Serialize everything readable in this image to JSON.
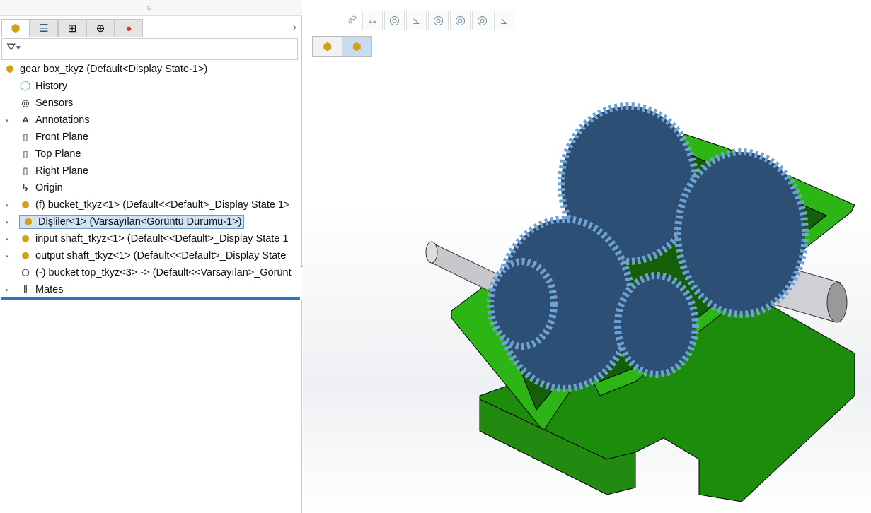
{
  "tabs": [
    {
      "name": "feature-manager",
      "icon": "assembly-icon",
      "active": true
    },
    {
      "name": "property-manager",
      "icon": "property-list-icon"
    },
    {
      "name": "configuration-manager",
      "icon": "configuration-icon"
    },
    {
      "name": "dimxpert-manager",
      "icon": "crosshair-icon"
    },
    {
      "name": "display-manager",
      "icon": "appearance-icon"
    }
  ],
  "filter": {
    "icon": "filter-icon"
  },
  "tree": {
    "root": "gear box_tkyz  (Default<Display State-1>)",
    "items": [
      {
        "label": "History",
        "icon": "history-icon",
        "expandable": false
      },
      {
        "label": "Sensors",
        "icon": "sensors-icon",
        "expandable": false
      },
      {
        "label": "Annotations",
        "icon": "annotations-icon",
        "expandable": true
      },
      {
        "label": "Front Plane",
        "icon": "plane-icon",
        "expandable": false
      },
      {
        "label": "Top Plane",
        "icon": "plane-icon",
        "expandable": false
      },
      {
        "label": "Right Plane",
        "icon": "plane-icon",
        "expandable": false
      },
      {
        "label": "Origin",
        "icon": "origin-icon",
        "expandable": false
      },
      {
        "label": "(f) bucket_tkyz<1> (Default<<Default>_Display State 1>",
        "icon": "part-icon",
        "expandable": true
      },
      {
        "label": "Dişliler<1> (Varsayılan<Görüntü Durumu-1>)",
        "icon": "subassembly-icon",
        "expandable": true,
        "selected": true
      },
      {
        "label": "input shaft_tkyz<1> (Default<<Default>_Display State 1",
        "icon": "part-icon",
        "expandable": true
      },
      {
        "label": "output shaft_tkyz<1> (Default<<Default>_Display State",
        "icon": "part-icon",
        "expandable": true
      },
      {
        "label": "(-) bucket top_tkyz<3> -> (Default<<Varsayılan>_Görünt",
        "icon": "suppressed-part-icon",
        "expandable": false
      },
      {
        "label": "Mates",
        "icon": "mates-icon",
        "expandable": true
      }
    ]
  },
  "hud": [
    "pointer-icon",
    "dimension-icon",
    "concentric-icon",
    "angle-icon",
    "concentric-icon",
    "concentric-icon",
    "concentric-icon",
    "angle-icon"
  ],
  "breadcrumb": [
    "assembly-icon",
    "subassembly-icon"
  ],
  "colors": {
    "selection": "#cfe3f5",
    "housing": "#22a00e",
    "gear": "#3f6fa0",
    "shaft": "#c8c8cc"
  }
}
